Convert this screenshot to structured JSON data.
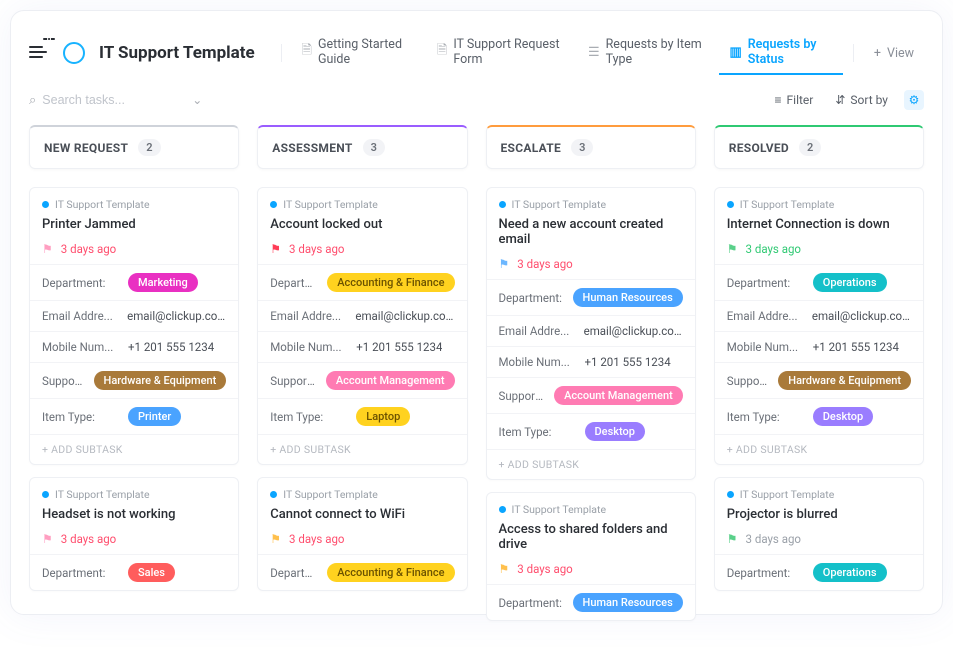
{
  "header": {
    "title": "IT Support Template",
    "menu_badge": "0",
    "tabs": [
      {
        "label": "Getting Started Guide"
      },
      {
        "label": "IT Support Request Form"
      },
      {
        "label": "Requests by Item Type"
      },
      {
        "label": "Requests by Status"
      }
    ],
    "add_view": "View"
  },
  "toolbar": {
    "search_placeholder": "Search tasks...",
    "filter": "Filter",
    "sort": "Sort by"
  },
  "labels": {
    "department": "Department:",
    "email": "Email Addre...",
    "mobile": "Mobile Num...",
    "support": "Support Nee...",
    "item": "Item Type:",
    "add_subtask": "+ ADD SUBTASK",
    "project": "IT Support Template"
  },
  "columns": [
    {
      "title": "NEW REQUEST",
      "count": "2",
      "accent": "accent-grey",
      "cards": [
        {
          "title": "Printer Jammed",
          "flag_color": "#ff9fc1",
          "date": "3 days ago",
          "date_color": "#ff4d6d",
          "dept": {
            "text": "Marketing",
            "cls": "c-magenta"
          },
          "email": "email@clickup.com",
          "mobile": "+1 201 555 1234",
          "support": {
            "text": "Hardware & Equipment",
            "cls": "c-brown"
          },
          "item": {
            "text": "Printer",
            "cls": "c-blue"
          },
          "subtask": true
        },
        {
          "title": "Headset is not working",
          "flag_color": "#ff9fc1",
          "date": "3 days ago",
          "date_color": "#ff4d6d",
          "dept": {
            "text": "Sales",
            "cls": "c-red"
          }
        }
      ]
    },
    {
      "title": "ASSESSMENT",
      "count": "3",
      "accent": "accent-purple",
      "cards": [
        {
          "title": "Account locked out",
          "flag_color": "#ff3d57",
          "date": "3 days ago",
          "date_color": "#ff4d6d",
          "dept": {
            "text": "Accounting & Finance",
            "cls": "c-yellow"
          },
          "email": "email@clickup.com",
          "mobile": "+1 201 555 1234",
          "support": {
            "text": "Account Management",
            "cls": "c-pink"
          },
          "item": {
            "text": "Laptop",
            "cls": "c-yellow"
          },
          "subtask": true
        },
        {
          "title": "Cannot connect to WiFi",
          "flag_color": "#ffc04d",
          "date": "3 days ago",
          "date_color": "#ff4d6d",
          "dept": {
            "text": "Accounting & Finance",
            "cls": "c-yellow"
          }
        }
      ]
    },
    {
      "title": "ESCALATE",
      "count": "3",
      "accent": "accent-orange",
      "cards": [
        {
          "title": "Need a new account created email",
          "flag_color": "#6bb7ff",
          "date": "3 days ago",
          "date_color": "#ff4d6d",
          "dept": {
            "text": "Human Resources",
            "cls": "c-blue"
          },
          "email": "email@clickup.com",
          "mobile": "+1 201 555 1234",
          "support": {
            "text": "Account Management",
            "cls": "c-pink"
          },
          "item": {
            "text": "Desktop",
            "cls": "c-lav"
          },
          "subtask": true
        },
        {
          "title": "Access to shared folders and drive",
          "flag_color": "#ffc04d",
          "date": "3 days ago",
          "date_color": "#ff4d6d",
          "dept": {
            "text": "Human Resources",
            "cls": "c-blue"
          }
        }
      ]
    },
    {
      "title": "RESOLVED",
      "count": "2",
      "accent": "accent-green",
      "cards": [
        {
          "title": "Internet Connection is down",
          "flag_color": "#5ad08a",
          "date": "3 days ago",
          "date_color": "#2fc973",
          "dept": {
            "text": "Operations",
            "cls": "c-teal"
          },
          "email": "email@clickup.com",
          "mobile": "+1 201 555 1234",
          "support": {
            "text": "Hardware & Equipment",
            "cls": "c-brown"
          },
          "item": {
            "text": "Desktop",
            "cls": "c-lav"
          },
          "subtask": true
        },
        {
          "title": "Projector is blurred",
          "flag_color": "#5ad08a",
          "date": "3 days ago",
          "date_color": "#9aa0a8",
          "dept": {
            "text": "Operations",
            "cls": "c-teal"
          }
        }
      ]
    }
  ]
}
